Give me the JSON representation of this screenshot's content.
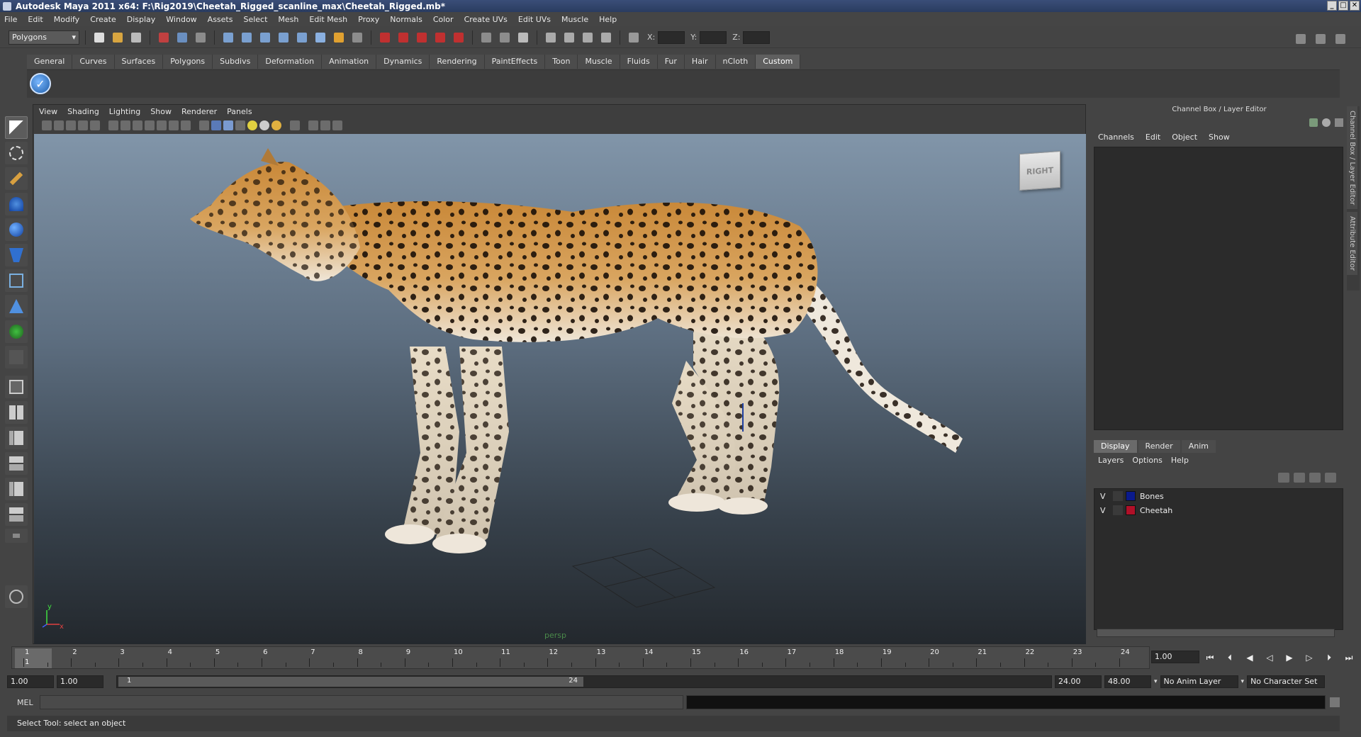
{
  "window": {
    "title": "Autodesk Maya 2011 x64: F:\\Rig2019\\Cheetah_Rigged_scanline_max\\Cheetah_Rigged.mb*"
  },
  "menubar": [
    "File",
    "Edit",
    "Modify",
    "Create",
    "Display",
    "Window",
    "Assets",
    "Select",
    "Mesh",
    "Edit Mesh",
    "Proxy",
    "Normals",
    "Color",
    "Create UVs",
    "Edit UVs",
    "Muscle",
    "Help"
  ],
  "statusline": {
    "mode": "Polygons",
    "x_label": "X:",
    "y_label": "Y:",
    "z_label": "Z:"
  },
  "shelf": {
    "tabs": [
      "General",
      "Curves",
      "Surfaces",
      "Polygons",
      "Subdivs",
      "Deformation",
      "Animation",
      "Dynamics",
      "Rendering",
      "PaintEffects",
      "Toon",
      "Muscle",
      "Fluids",
      "Fur",
      "Hair",
      "nCloth",
      "Custom"
    ],
    "active": "Custom",
    "button_icon": "checkmark-icon"
  },
  "panel": {
    "menus": [
      "View",
      "Shading",
      "Lighting",
      "Show",
      "Renderer",
      "Panels"
    ],
    "viewcube_label": "RIGHT",
    "camera": "persp",
    "axis_x": "x",
    "axis_y": "y"
  },
  "rightpanel": {
    "title": "Channel Box / Layer Editor",
    "menus": [
      "Channels",
      "Edit",
      "Object",
      "Show"
    ],
    "tabs": [
      "Display",
      "Render",
      "Anim"
    ],
    "active_tab": "Display",
    "layer_menus": [
      "Layers",
      "Options",
      "Help"
    ],
    "layers": [
      {
        "vis": "V",
        "name": "Bones",
        "color": "#0a1a8c"
      },
      {
        "vis": "V",
        "name": "Cheetah",
        "color": "#b01028"
      }
    ]
  },
  "sidetabs": [
    "Channel Box / Layer Editor",
    "Attribute Editor"
  ],
  "timeslider": {
    "ticks": [
      "1",
      "2",
      "3",
      "4",
      "5",
      "6",
      "7",
      "8",
      "9",
      "10",
      "11",
      "12",
      "13",
      "14",
      "15",
      "16",
      "17",
      "18",
      "19",
      "20",
      "21",
      "22",
      "23",
      "24"
    ],
    "current_marker": "1",
    "current_frame": "1.00"
  },
  "range": {
    "start": "1.00",
    "playback_start": "1.00",
    "handle_start": "1",
    "handle_end": "24",
    "playback_end": "24.00",
    "end": "48.00",
    "anim_layer": "No Anim Layer",
    "char_set": "No Character Set"
  },
  "cmdline": {
    "label": "MEL"
  },
  "helpline": {
    "text": "Select Tool: select an object"
  }
}
